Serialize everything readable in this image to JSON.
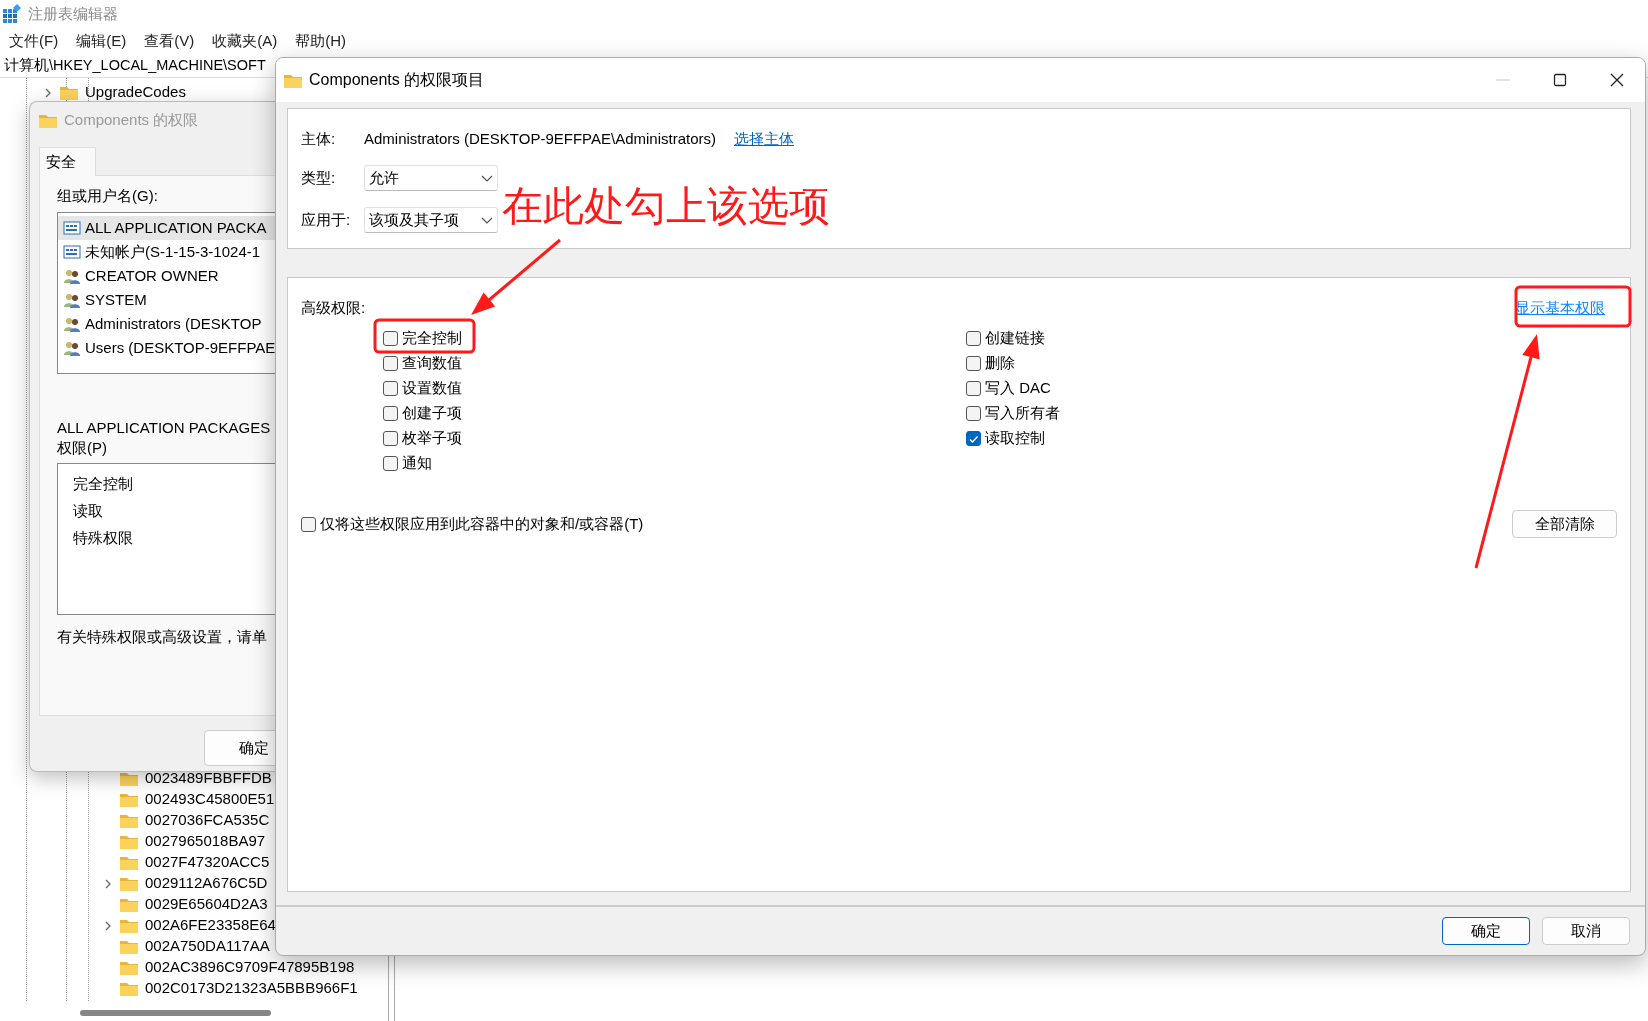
{
  "registry": {
    "title": "注册表编辑器",
    "menu": [
      "文件(F)",
      "编辑(E)",
      "查看(V)",
      "收藏夹(A)",
      "帮助(H)"
    ],
    "address": "计算机\\HKEY_LOCAL_MACHINE\\SOFT",
    "tree_top": [
      {
        "label": "UpgradeCodes",
        "expandable": true
      }
    ],
    "tree": [
      {
        "label": "0023489FBBFFDB",
        "expandable": false
      },
      {
        "label": "002493C45800E51",
        "expandable": false
      },
      {
        "label": "0027036FCA535C",
        "expandable": false
      },
      {
        "label": "0027965018BA97",
        "expandable": false
      },
      {
        "label": "0027F47320ACC5",
        "expandable": false
      },
      {
        "label": "0029112A676C5D",
        "expandable": true
      },
      {
        "label": "0029E65604D2A3",
        "expandable": false
      },
      {
        "label": "002A6FE23358E64",
        "expandable": true
      },
      {
        "label": "002A750DA117AA",
        "expandable": false
      },
      {
        "label": "002AC3896C9709F47895B198",
        "expandable": false
      },
      {
        "label": "002C0173D21323A5BBB966F1",
        "expandable": false
      }
    ]
  },
  "permissions_dialog": {
    "title": "Components 的权限",
    "tabs": [
      {
        "label": "安全",
        "selected": true
      }
    ],
    "group_label": "组或用户名(G):",
    "users": [
      {
        "label": "ALL APPLICATION PACKA",
        "kind": "package",
        "selected": true
      },
      {
        "label": "未知帐户(S-1-15-3-1024-1",
        "kind": "package",
        "selected": false
      },
      {
        "label": "CREATOR OWNER",
        "kind": "group",
        "selected": false
      },
      {
        "label": "SYSTEM",
        "kind": "group",
        "selected": false
      },
      {
        "label": "Administrators (DESKTOP",
        "kind": "group",
        "selected": false
      },
      {
        "label": "Users (DESKTOP-9EFFPAE",
        "kind": "group",
        "selected": false
      }
    ],
    "perm_heading": "ALL APPLICATION PACKAGES",
    "perm_label": "权限(P)",
    "perms": [
      "完全控制",
      "读取",
      "特殊权限"
    ],
    "note": "有关特殊权限或高级设置，请单",
    "ok": "确定"
  },
  "entry_dialog": {
    "title": "Components 的权限项目",
    "window_buttons": [
      {
        "kind": "minimize",
        "disabled": true
      },
      {
        "kind": "maximize",
        "disabled": false
      },
      {
        "kind": "close",
        "disabled": false
      }
    ],
    "principal_label": "主体:",
    "principal": "Administrators (DESKTOP-9EFFPAE\\Administrators)",
    "principal_link": "选择主体",
    "type_label": "类型:",
    "type_value": "允许",
    "apply_label": "应用于:",
    "apply_value": "该项及其子项",
    "section_label": "高级权限:",
    "basic_link": "显示基本权限",
    "perms_left": [
      {
        "label": "完全控制",
        "checked": false
      },
      {
        "label": "查询数值",
        "checked": false
      },
      {
        "label": "设置数值",
        "checked": false
      },
      {
        "label": "创建子项",
        "checked": false
      },
      {
        "label": "枚举子项",
        "checked": false
      },
      {
        "label": "通知",
        "checked": false
      }
    ],
    "perms_right": [
      {
        "label": "创建链接",
        "checked": false
      },
      {
        "label": "删除",
        "checked": false
      },
      {
        "label": "写入 DAC",
        "checked": false
      },
      {
        "label": "写入所有者",
        "checked": false
      },
      {
        "label": "读取控制",
        "checked": true
      }
    ],
    "only_apply": {
      "label": "仅将这些权限应用到此容器中的对象和/或容器(T)",
      "checked": false
    },
    "clear_all": "全部清除",
    "ok": "确定",
    "cancel": "取消"
  },
  "annotation": {
    "text": "在此处勾上该选项"
  }
}
